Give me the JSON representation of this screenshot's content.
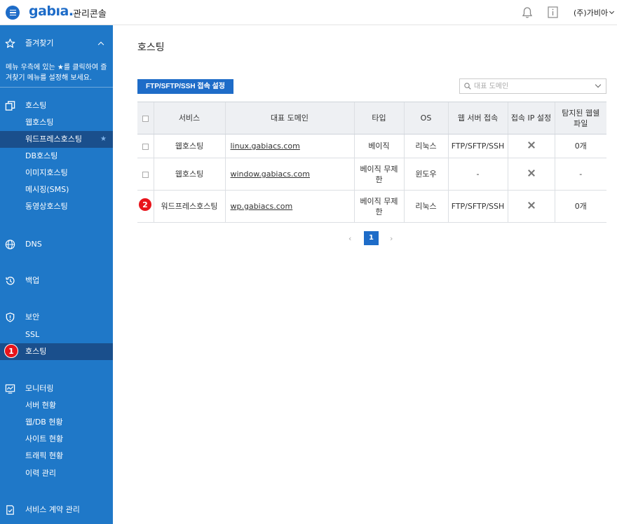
{
  "header": {
    "logo": "gabıa.",
    "console_title": "관리콘솔",
    "user_name": "(주)가비아"
  },
  "sidebar": {
    "favorites": {
      "label": "즐겨찾기",
      "description": "메뉴 우측에 있는 ★를 클릭하여 즐겨찾기 메뉴를 설정해 보세요."
    },
    "hosting": {
      "label": "호스팅",
      "items": [
        "웹호스팅",
        "워드프레스호스팅",
        "DB호스팅",
        "이미지호스팅",
        "메시징(SMS)",
        "동영상호스팅"
      ]
    },
    "dns": {
      "label": "DNS"
    },
    "backup": {
      "label": "백업"
    },
    "security": {
      "label": "보안",
      "items": [
        "SSL",
        "호스팅"
      ]
    },
    "monitoring": {
      "label": "모니터링",
      "items": [
        "서버 현황",
        "웹/DB 현황",
        "사이트 현황",
        "트래픽 현황",
        "이력 관리"
      ]
    },
    "contract": {
      "label": "서비스 계약 관리"
    }
  },
  "annotations": {
    "badge1": "1",
    "badge2": "2"
  },
  "main": {
    "title": "호스팅",
    "ftp_button": "FTP/SFTP/SSH 접속 설정",
    "search_placeholder": "대표 도메인",
    "table": {
      "headers": [
        "서비스",
        "대표 도메인",
        "타입",
        "OS",
        "웹 서버 접속",
        "접속 IP 설정",
        "탐지된 웹쉘 파일"
      ],
      "rows": [
        {
          "service": "웹호스팅",
          "domain": "linux.gabiacs.com",
          "type": "베이직",
          "os": "리눅스",
          "web": "FTP/SFTP/SSH",
          "shell": "0개"
        },
        {
          "service": "웹호스팅",
          "domain": "window.gabiacs.com",
          "type": "베이직 무제한",
          "os": "윈도우",
          "web": "-",
          "shell": "-"
        },
        {
          "service": "워드프레스호스팅",
          "domain": "wp.gabiacs.com",
          "type": "베이직 무제한",
          "os": "리눅스",
          "web": "FTP/SFTP/SSH",
          "shell": "0개"
        }
      ]
    },
    "pagination": {
      "prev": "‹",
      "current": "1",
      "next": "›"
    }
  },
  "colors": {
    "sidebar": "#1f78c8",
    "sidebar_active": "#1a4f8c",
    "accent": "#1e6cc8",
    "badge": "#e8141b"
  }
}
